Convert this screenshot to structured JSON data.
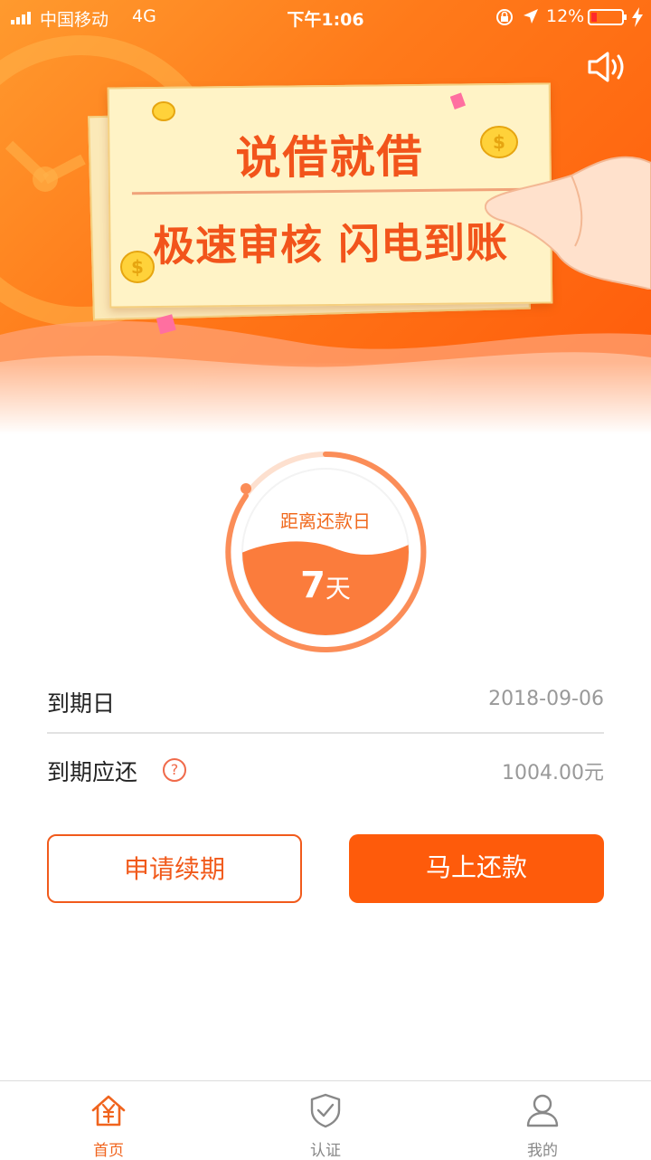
{
  "status_bar": {
    "carrier": "中国移动",
    "network": "4G",
    "time": "下午1:06",
    "battery_percent": "12%"
  },
  "banner": {
    "title": "说借就借",
    "subtitle": "极速审核 闪电到账"
  },
  "countdown": {
    "label": "距离还款日",
    "value": "7",
    "unit": "天"
  },
  "details": [
    {
      "label": "到期日",
      "value": "2018-09-06"
    },
    {
      "label": "到期应还",
      "value": "1004.00元"
    }
  ],
  "buttons": {
    "renew": "申请续期",
    "repay": "马上还款"
  },
  "tabs": [
    {
      "label": "首页",
      "icon": "home-yuan-icon",
      "active": true
    },
    {
      "label": "认证",
      "icon": "shield-check-icon",
      "active": false
    },
    {
      "label": "我的",
      "icon": "user-icon",
      "active": false
    }
  ],
  "colors": {
    "accent": "#fe5b0b",
    "banner_text": "#f2541b",
    "tab_active": "#f0641e"
  }
}
